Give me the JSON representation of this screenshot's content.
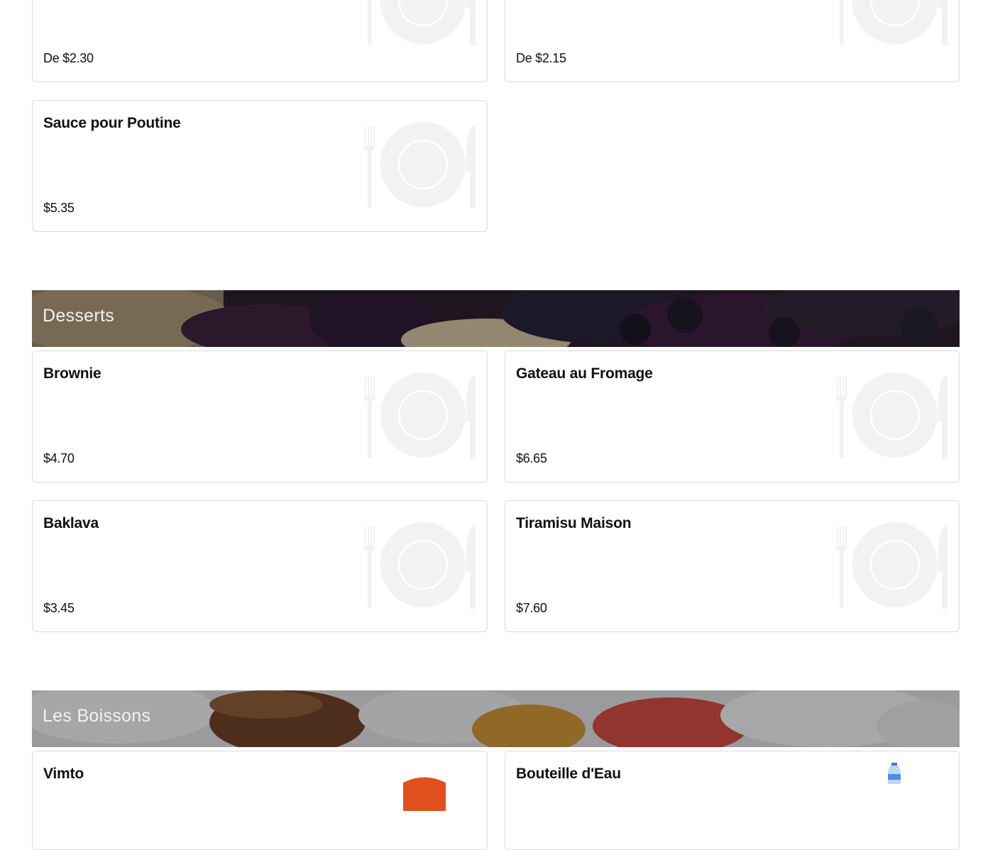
{
  "sections": {
    "desserts": {
      "title": "Desserts"
    },
    "boissons": {
      "title": "Les Boissons"
    }
  },
  "items": {
    "top_left": {
      "price": "De $2.30"
    },
    "top_right": {
      "price": "De $2.15"
    },
    "sauce": {
      "name": "Sauce pour Poutine",
      "price": "$5.35"
    },
    "brownie": {
      "name": "Brownie",
      "price": "$4.70"
    },
    "gateau": {
      "name": "Gateau au Fromage",
      "price": "$6.65"
    },
    "baklava": {
      "name": "Baklava",
      "price": "$3.45"
    },
    "tiramisu": {
      "name": "Tiramisu Maison",
      "price": "$7.60"
    },
    "vimto": {
      "name": "Vimto"
    },
    "eau": {
      "name": "Bouteille d'Eau"
    }
  },
  "icons": {
    "placeholder": "plate-cutlery-icon",
    "vimto": "vimto-bottle-image",
    "water": "water-bottle-image"
  },
  "colors": {
    "card_border": "#dcdcdc",
    "placeholder": "#f2f2f2",
    "banner_text": "#f2f2f2"
  }
}
